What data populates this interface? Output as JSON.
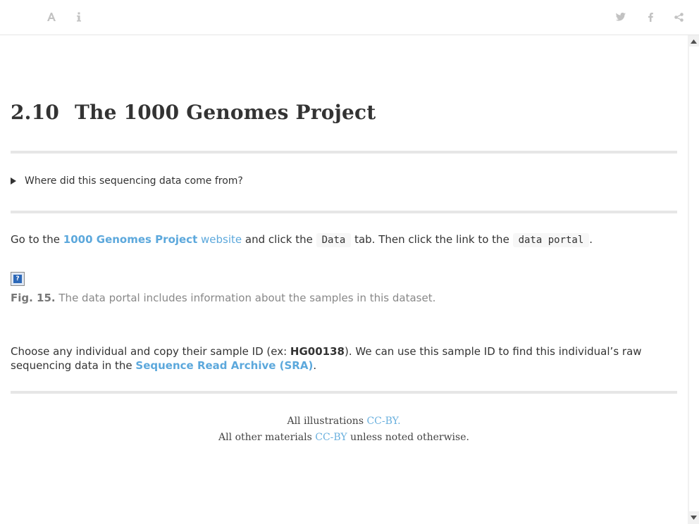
{
  "toolbar": {
    "left_icons": [
      "font-settings-icon",
      "info-icon"
    ],
    "right_icons": [
      "twitter-icon",
      "facebook-icon",
      "share-icon"
    ]
  },
  "section": {
    "number": "2.10",
    "title": "The 1000 Genomes Project"
  },
  "details": {
    "summary": "Where did this sequencing data come from?"
  },
  "paragraph1": {
    "t1": "Go to the ",
    "link1": "1000 Genomes Project",
    "link2": "website",
    "t2": " and click the ",
    "code1": "Data",
    "t3": " tab. Then click the link to the ",
    "code2": "data portal",
    "t4": "."
  },
  "figure": {
    "image_icon": "broken-image-icon",
    "image_glyph": "?",
    "label": "Fig. 15.",
    "caption": " The data portal includes information about the samples in this dataset."
  },
  "paragraph2": {
    "t1": "Choose any individual and copy their sample ID (ex: ",
    "sample_id": "HG00138",
    "t2": "). We can use this sample ID to find this individual’s raw sequencing data in the ",
    "link": "Sequence Read Archive (SRA)",
    "t3": "."
  },
  "footer": {
    "line1_text": "All illustrations ",
    "line1_link": "CC-BY.",
    "line2_text": "All other materials ",
    "line2_link": "CC-BY",
    "line2_tail": " unless noted otherwise."
  },
  "colors": {
    "link": "#5ca8dc",
    "rule": "#e6e6e6",
    "icon": "#c2c2c2"
  }
}
